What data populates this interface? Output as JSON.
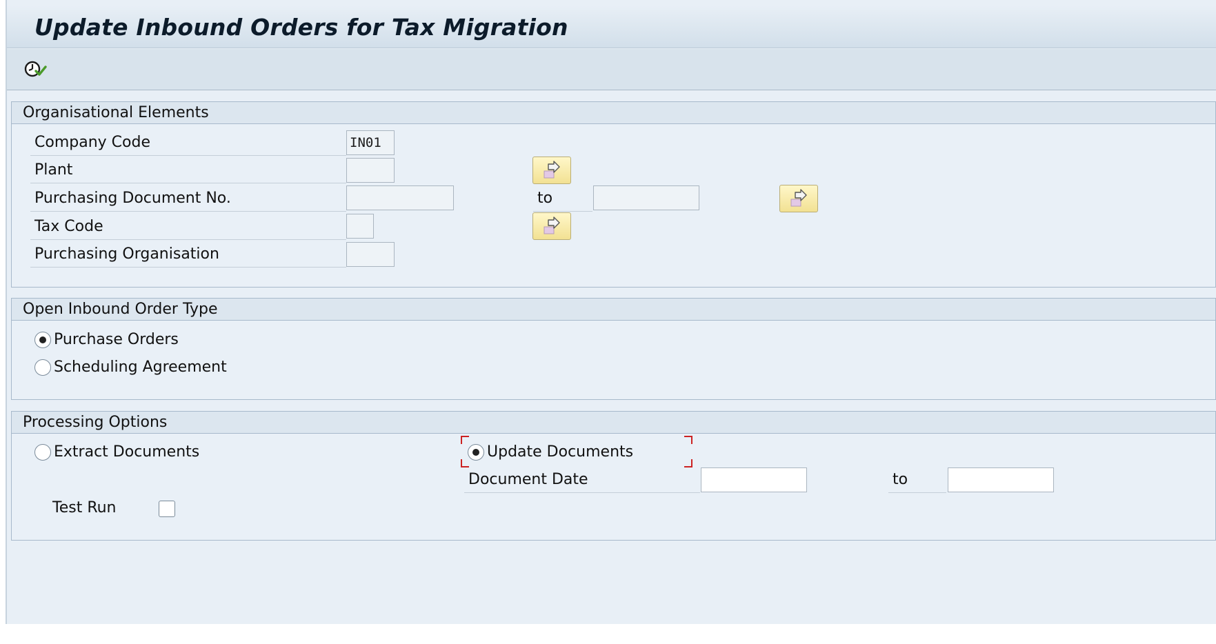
{
  "header": {
    "title": "Update Inbound Orders for Tax Migration"
  },
  "toolbar": {
    "execute_icon": "execute-clock-icon"
  },
  "org_elements": {
    "title": "Organisational Elements",
    "company_code_label": "Company Code",
    "company_code_value": "IN01",
    "plant_label": "Plant",
    "plant_value": "",
    "purch_doc_label": "Purchasing Document No.",
    "purch_doc_from": "",
    "purch_doc_to_label": "to",
    "purch_doc_to": "",
    "tax_code_label": "Tax Code",
    "tax_code_value": "",
    "purch_org_label": "Purchasing Organisation",
    "purch_org_value": ""
  },
  "order_type": {
    "title": "Open Inbound Order Type",
    "purchase_orders_label": "Purchase Orders",
    "purchase_orders_selected": true,
    "scheduling_agreement_label": "Scheduling Agreement",
    "scheduling_agreement_selected": false
  },
  "processing": {
    "title": "Processing Options",
    "extract_label": "Extract Documents",
    "extract_selected": false,
    "update_label": "Update Documents",
    "update_selected": true,
    "doc_date_label": "Document Date",
    "doc_date_from": "",
    "doc_date_to_label": "to",
    "doc_date_to": "",
    "test_run_label": "Test Run",
    "test_run_checked": false
  },
  "colors": {
    "background": "#e9f0f7",
    "header_band": "#dce6ef",
    "multi_select_button": "#f2e193",
    "focus_marker": "#cc2222"
  }
}
